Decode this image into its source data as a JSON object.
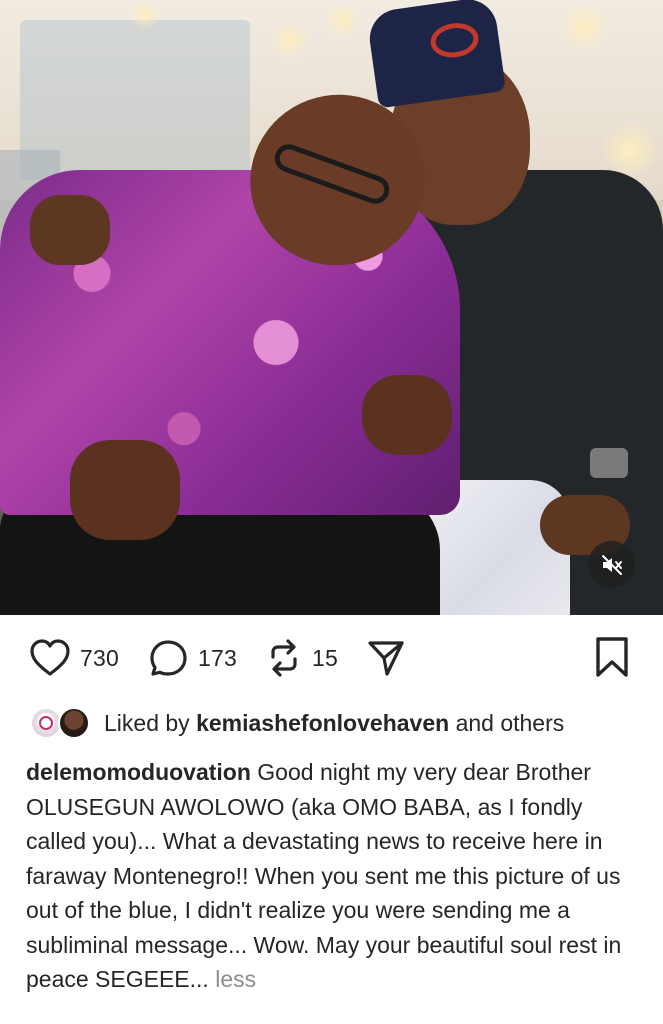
{
  "post": {
    "media_alt": "Photo of two men seated together at an event",
    "mute_icon": "speaker-muted-icon",
    "actions": {
      "like_count": "730",
      "comment_count": "173",
      "repost_count": "15",
      "like_icon": "heart-outline-icon",
      "comment_icon": "speech-bubble-icon",
      "repost_icon": "repost-arrows-icon",
      "share_icon": "paper-plane-icon",
      "save_icon": "bookmark-outline-icon"
    },
    "liked_by": {
      "prefix": "Liked by",
      "user": "kemiashefonlovehaven",
      "suffix": "and others"
    },
    "caption": {
      "username": "delemomoduovation",
      "text": "Good night my very dear Brother OLUSEGUN AWOLOWO (aka OMO BABA, as I fondly called you)... What a devastating news to receive here in faraway Montenegro!! When you sent me this picture of us out of the blue, I didn't realize you were sending me a subliminal message... Wow. May your beautiful soul rest in peace SEGEEE...",
      "toggle": "less"
    }
  }
}
